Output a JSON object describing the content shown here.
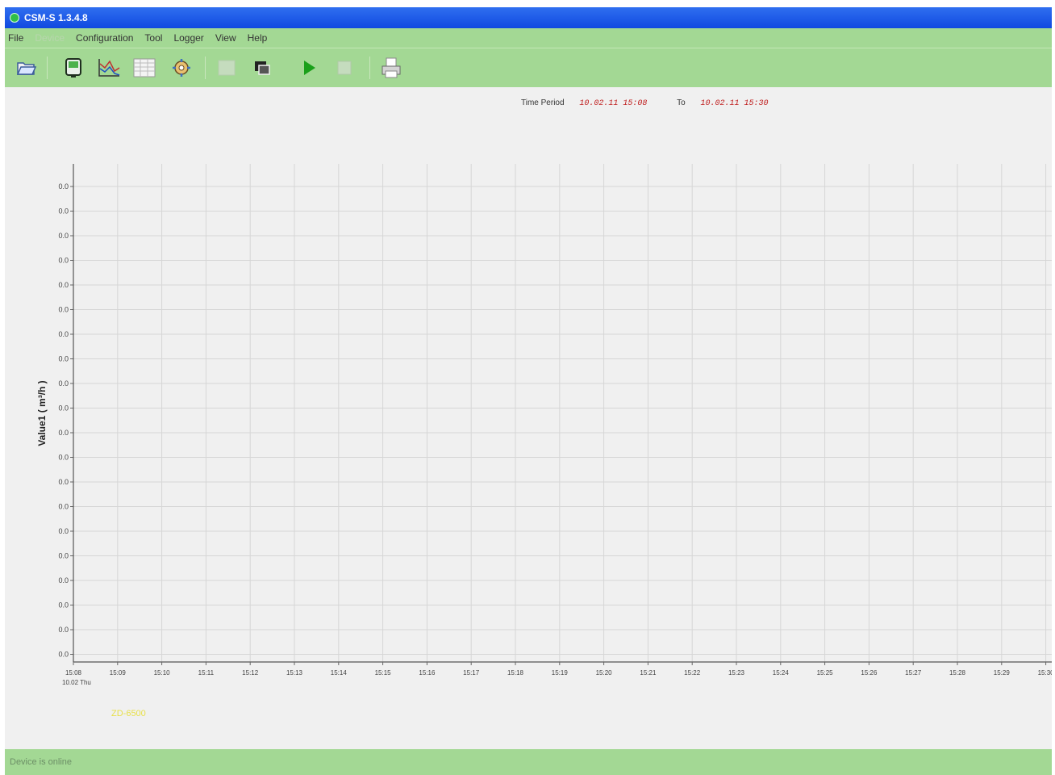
{
  "window": {
    "title": "CSM-S 1.3.4.8"
  },
  "menu": [
    "File",
    "Device",
    "Configuration",
    "Tool",
    "Logger",
    "View",
    "Help"
  ],
  "toolbar_icons": [
    "open-folder-icon",
    "device-icon",
    "chart-icon",
    "table-icon",
    "settings-icon",
    "disabled-icon",
    "window-icon",
    "play-icon",
    "stop-icon",
    "print-icon"
  ],
  "header": {
    "time_period_label": "Time Period",
    "from": "10.02.11 15:08",
    "to_label": "To",
    "to": "10.02.11 15:30"
  },
  "chart_data": {
    "type": "line",
    "ylabel": "Value1 ( m³/h )",
    "y_ticks": [
      "0.0",
      "0.0",
      "0.0",
      "0.0",
      "0.0",
      "0.0",
      "0.0",
      "0.0",
      "0.0",
      "0.0",
      "0.0",
      "0.0",
      "0.0",
      "0.0",
      "0.0",
      "0.0",
      "0.0",
      "0.0",
      "0.0",
      "0.0"
    ],
    "x_ticks": [
      "15:08",
      "15:09",
      "15:10",
      "15:11",
      "15:12",
      "15:13",
      "15:14",
      "15:15",
      "15:16",
      "15:17",
      "15:18",
      "15:19",
      "15:20",
      "15:21",
      "15:22",
      "15:23",
      "15:24",
      "15:25",
      "15:26",
      "15:27",
      "15:28",
      "15:29",
      "15:30"
    ],
    "x_sub": "10.02 Thu",
    "grid": true,
    "series": []
  },
  "legend": "ZD-6500",
  "status": "Device is online"
}
